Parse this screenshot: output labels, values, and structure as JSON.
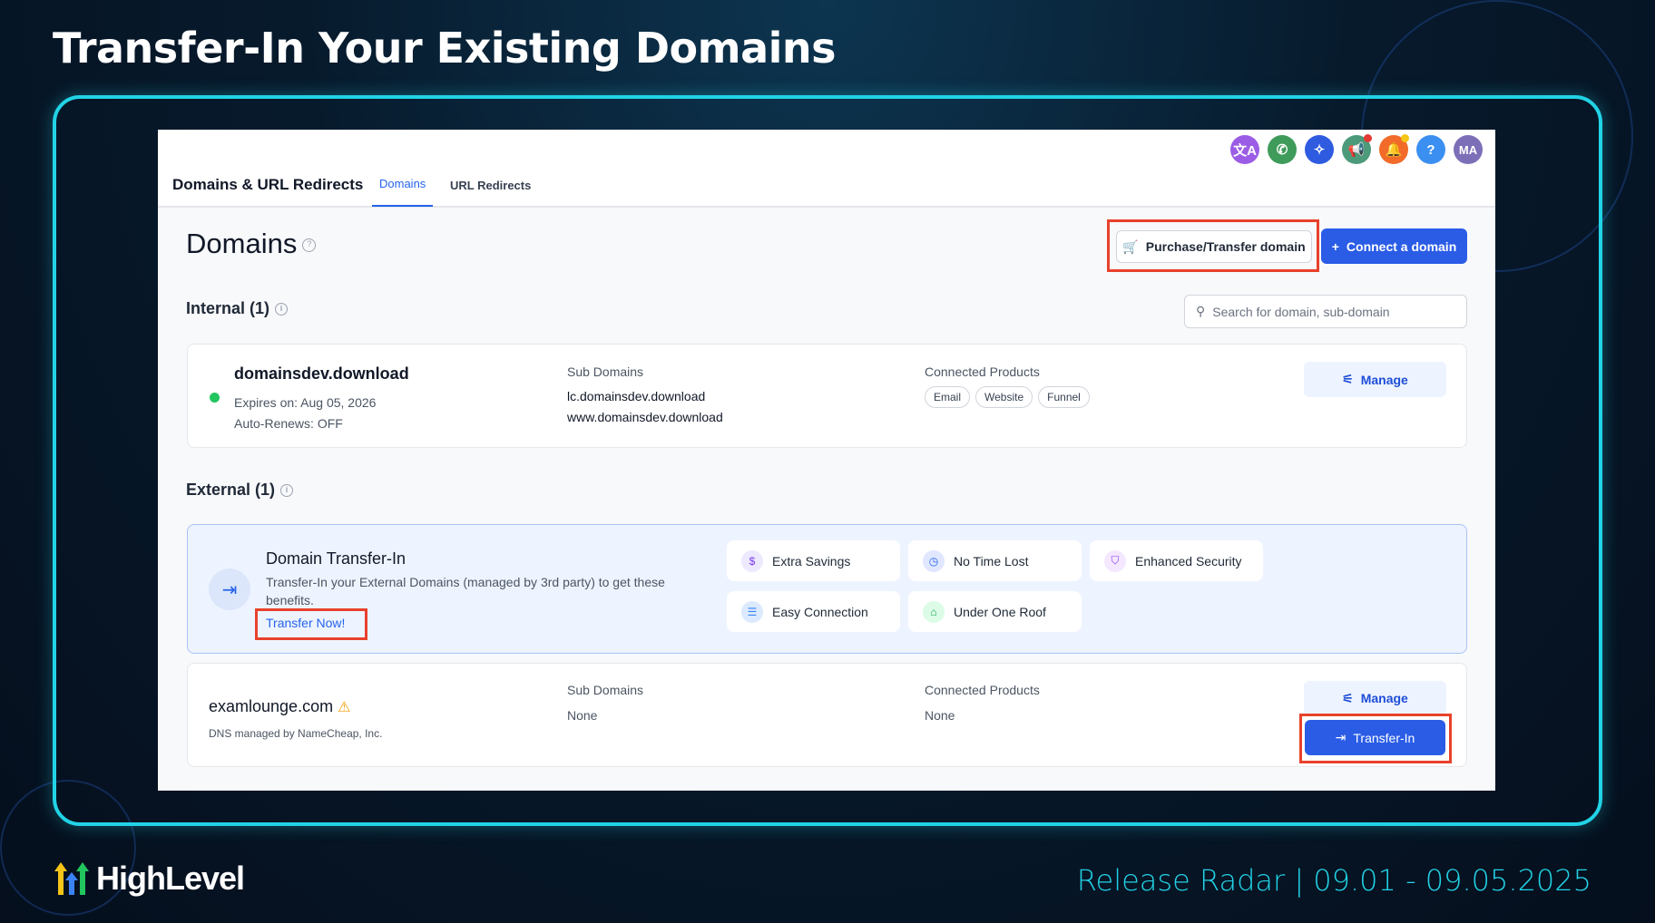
{
  "banner": {
    "title": "Transfer-In Your Existing Domains",
    "brand": "HighLevel",
    "release": "Release Radar | 09.01 - 09.05.2025"
  },
  "header": {
    "title": "Domains & URL Redirects",
    "tabs": [
      {
        "label": "Domains",
        "active": true
      },
      {
        "label": "URL Redirects",
        "active": false
      }
    ],
    "icons": [
      {
        "name": "translate-icon",
        "glyph": "文A",
        "color": "#9b5de5"
      },
      {
        "name": "phone-icon",
        "glyph": "✆",
        "color": "#3f9b5a"
      },
      {
        "name": "sparkle-icon",
        "glyph": "✧",
        "color": "#2f5be0"
      },
      {
        "name": "megaphone-icon",
        "glyph": "📢",
        "color": "#4c9a7a"
      },
      {
        "name": "bell-icon",
        "glyph": "🔔",
        "color": "#f26b2a"
      },
      {
        "name": "help-icon",
        "glyph": "?",
        "color": "#3b8ff0"
      },
      {
        "name": "avatar",
        "glyph": "MA",
        "color": "#7c6fb8"
      }
    ]
  },
  "page": {
    "title": "Domains",
    "purchase_label": "Purchase/Transfer domain",
    "connect_label": "Connect a domain",
    "search_placeholder": "Search for domain, sub-domain"
  },
  "internal": {
    "heading": "Internal (1)",
    "domain": {
      "name": "domainsdev.download",
      "expires": "Expires on: Aug 05, 2026",
      "renew": "Auto-Renews: OFF",
      "sub_label": "Sub Domains",
      "subs": [
        "lc.domainsdev.download",
        "www.domainsdev.download"
      ],
      "prod_label": "Connected Products",
      "products": [
        "Email",
        "Website",
        "Funnel"
      ],
      "manage": "Manage"
    }
  },
  "external": {
    "heading": "External (1)",
    "promo": {
      "title": "Domain Transfer-In",
      "desc": "Transfer-In your External Domains (managed by 3rd party) to get these benefits.",
      "link": "Transfer Now!",
      "benefits": [
        {
          "label": "Extra Savings",
          "icon": "$",
          "color": "#7c3aed",
          "bg": "#ede9fe"
        },
        {
          "label": "No Time Lost",
          "icon": "◷",
          "color": "#2563eb",
          "bg": "#e0e7ff"
        },
        {
          "label": "Enhanced Security",
          "icon": "⛉",
          "color": "#9333ea",
          "bg": "#f3e8ff"
        },
        {
          "label": "Easy Connection",
          "icon": "☰",
          "color": "#3b82f6",
          "bg": "#dbeafe"
        },
        {
          "label": "Under One Roof",
          "icon": "⌂",
          "color": "#16a34a",
          "bg": "#dcfce7"
        }
      ]
    },
    "domain": {
      "name": "examlounge.com",
      "dns": "DNS managed by NameCheap, Inc.",
      "sub_label": "Sub Domains",
      "subs": "None",
      "prod_label": "Connected Products",
      "products": "None",
      "manage": "Manage",
      "transfer": "Transfer-In"
    }
  }
}
